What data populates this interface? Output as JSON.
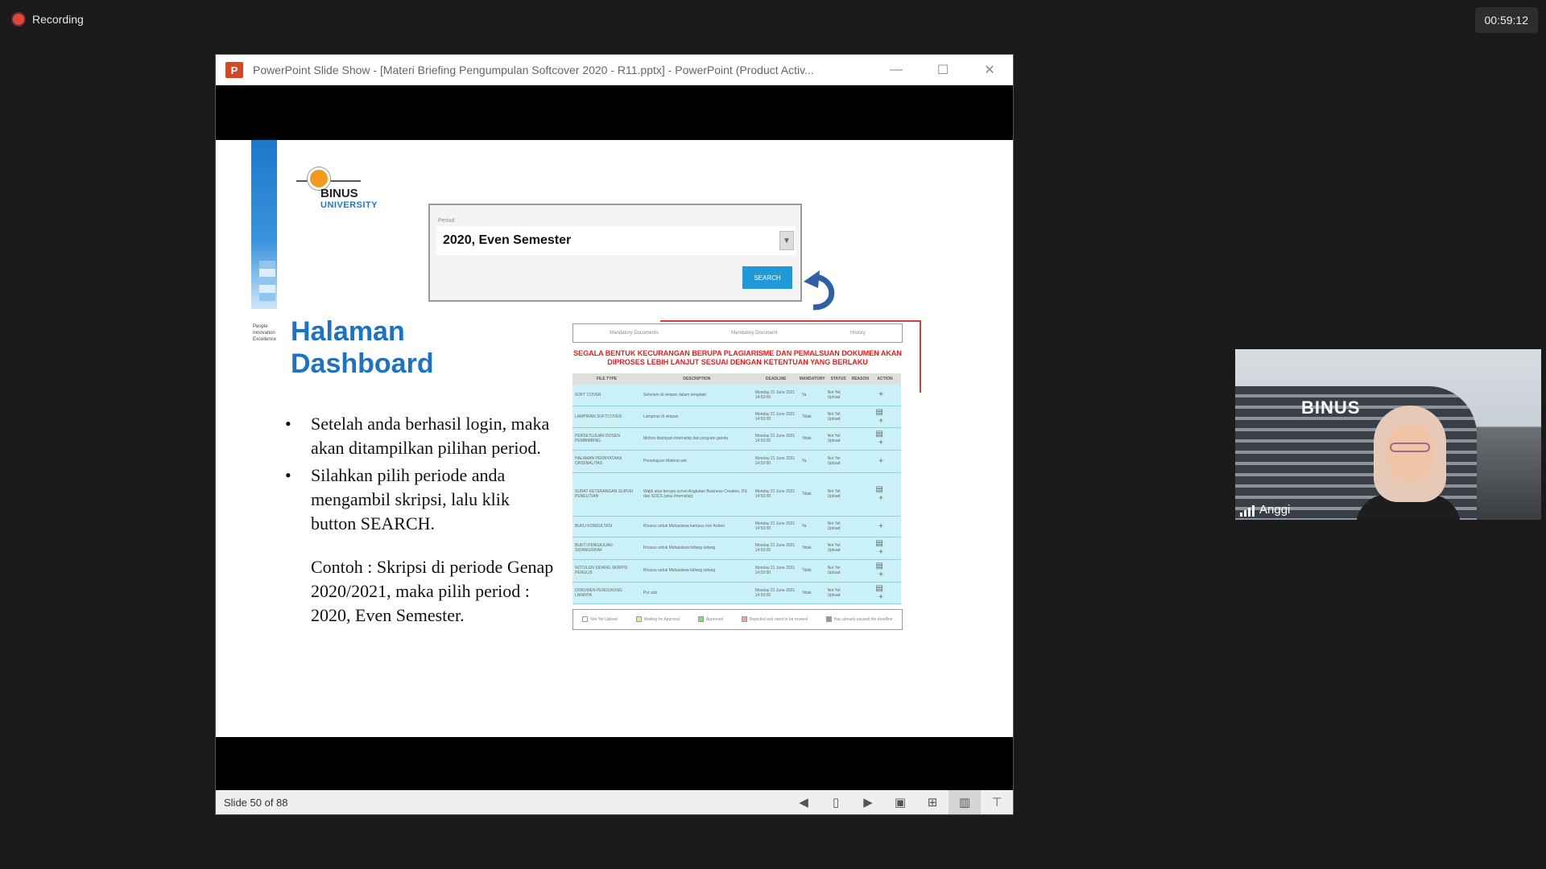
{
  "recording": {
    "label": "Recording"
  },
  "timer": "00:59:12",
  "window": {
    "app_icon": "P",
    "title": "PowerPoint Slide Show - [Materi Briefing Pengumpulan Softcover 2020 - R11.pptx] - PowerPoint (Product Activ...",
    "minimize": "—",
    "maximize": "☐",
    "close": "✕"
  },
  "slide": {
    "logo_name": "BINUS",
    "logo_sub": "UNIVERSITY",
    "tagline": "People Innovation Excellence",
    "heading_line1": "Halaman",
    "heading_line2": "Dashboard",
    "bullet1": "Setelah anda berhasil login, maka akan ditampilkan pilihan period.",
    "bullet2": "Silahkan pilih periode anda mengambil skripsi, lalu klik button SEARCH.",
    "example": "Contoh : Skripsi di periode Genap 2020/2021, maka pilih period : 2020, Even Semester.",
    "period_label": "Period",
    "period_value": "2020, Even Semester",
    "search_label": "SEARCH",
    "dash_tab1": "Mandatory Documents",
    "dash_tab2": "Mandatory Document",
    "dash_tab3": "History",
    "warning": "SEGALA BENTUK KECURANGAN BERUPA PLAGIARISME DAN PEMALSUAN DOKUMEN AKAN DIPROSES LEBIH LANJUT SESUAI DENGAN KETENTUAN YANG BERLAKU",
    "headers": [
      "FILE TYPE",
      "DESCRIPTION",
      "DEADLINE",
      "MANDATORY",
      "STATUS",
      "REASON",
      "ACTION"
    ],
    "rows": [
      [
        "SOFT COVER",
        "Sebelum di simpan dalam template",
        "Monday 21 June 2021 14:53:00",
        "Ya",
        "Not Yet Upload",
        "",
        "+"
      ],
      [
        "LAMPIRAN SOFTCOVER",
        "Lampiran di simpan",
        "Monday 21 June 2021 14:53:00",
        "Tidak",
        "Not Yet Upload",
        "",
        "▤ +"
      ],
      [
        "PERSETUJUAN DOSEN PEMBIMBING",
        "Mohon disimpan Internship dan program ganda",
        "Monday 21 June 2021 14:53:00",
        "Tidak",
        "Not Yet Upload",
        "",
        "▤ +"
      ],
      [
        "HALAMAN PERNYATAAN ORISINALITAS",
        "Persetujuan Materai asli",
        "Monday 21 June 2021 14:53:00",
        "Ya",
        "Not Yet Upload",
        "",
        "+"
      ],
      [
        "SURAT KETERANGAN SURVEI PENELITIAN",
        "Wajib atas berupa survei Angkatan Business Creation, DS dan SOCS (atau Internship)",
        "Monday 21 June 2021 14:53:00",
        "Tidak",
        "Not Yet Upload",
        "",
        "▤ +"
      ],
      [
        "BUKU KONSULTASI",
        "Khusus untuk Mahasiswa kampus non Kebon",
        "Monday 21 June 2021 14:53:00",
        "Ya",
        "Not Yet Upload",
        "",
        "+"
      ],
      [
        "BUKTI PENGAJUAN SIDANG/DRAF",
        "Khusus untuk Mahasiswa bidang sidang",
        "Monday 21 June 2021 14:53:00",
        "Tidak",
        "Not Yet Upload",
        "",
        "▤ +"
      ],
      [
        "NOTULEN SIDANG SKRIPSI PENGUJI",
        "Khusus untuk Mahasiswa bidang sidang",
        "Monday 21 June 2021 14:53:00",
        "Tidak",
        "Not Yet Upload",
        "",
        "▤ +"
      ],
      [
        "DOKUMEN PENDUKUNG LAINNYA",
        "Pur ado",
        "Monday 21 June 2021 14:53:00",
        "Tidak",
        "Not Yet Upload",
        "",
        "▤ +"
      ]
    ],
    "legend": [
      "Not Yet Upload",
      "Waiting for Approval",
      "Approved",
      "Rejected and need to be revised",
      "Has already passed the deadline"
    ]
  },
  "status": {
    "slide_counter": "Slide 50 of 88"
  },
  "webcam": {
    "name": "Anggi",
    "backdrop_text": "BINUS"
  },
  "colors": {
    "accent": "#1a73c8",
    "warning": "#e02020",
    "table_row": "#c9f1f7",
    "search": "#1e9ad6"
  }
}
